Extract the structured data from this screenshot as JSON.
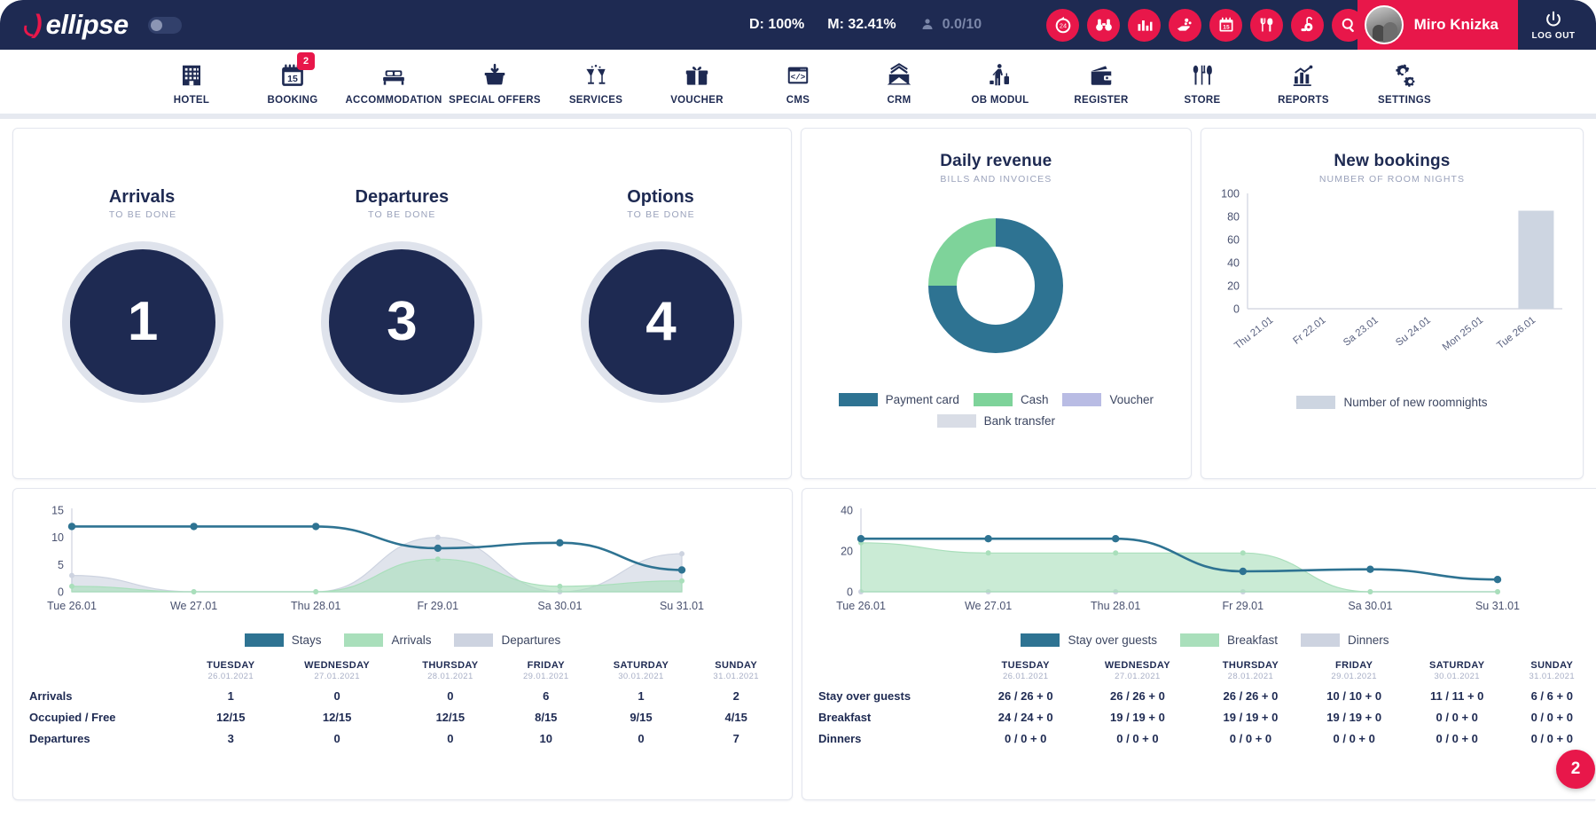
{
  "brand": {
    "name": "ellipse"
  },
  "topbar": {
    "toggle_name": "sidebar-toggle",
    "status": {
      "d_label": "D: 100%",
      "m_label": "M: 32.41%",
      "guest_rating": "0.0/10"
    },
    "icons": [
      {
        "name": "24h-clock-icon"
      },
      {
        "name": "binoculars-icon"
      },
      {
        "name": "bar-chart-icon"
      },
      {
        "name": "housekeeping-icon"
      },
      {
        "name": "calendar-icon"
      },
      {
        "name": "restaurant-icon"
      },
      {
        "name": "vacuum-icon"
      },
      {
        "name": "search-icon"
      }
    ],
    "user": {
      "name": "Miro Knizka"
    },
    "logout": {
      "label": "LOG OUT"
    }
  },
  "mainnav": [
    {
      "label": "HOTEL",
      "icon": "hotel-icon",
      "badge": null
    },
    {
      "label": "BOOKING",
      "icon": "calendar-15-icon",
      "badge": "2"
    },
    {
      "label": "ACCOMMODATION",
      "icon": "bed-icon",
      "badge": null
    },
    {
      "label": "SPECIAL OFFERS",
      "icon": "package-icon",
      "badge": null
    },
    {
      "label": "SERVICES",
      "icon": "cheers-icon",
      "badge": null
    },
    {
      "label": "VOUCHER",
      "icon": "gift-icon",
      "badge": null
    },
    {
      "label": "CMS",
      "icon": "code-window-icon",
      "badge": null
    },
    {
      "label": "CRM",
      "icon": "envelope-icon",
      "badge": null
    },
    {
      "label": "OB MODUL",
      "icon": "traveler-icon",
      "badge": null
    },
    {
      "label": "REGISTER",
      "icon": "wallet-icon",
      "badge": null
    },
    {
      "label": "STORE",
      "icon": "cutlery-icon",
      "badge": null
    },
    {
      "label": "REPORTS",
      "icon": "report-chart-icon",
      "badge": null
    },
    {
      "label": "SETTINGS",
      "icon": "gears-icon",
      "badge": null
    }
  ],
  "kpis": [
    {
      "title": "Arrivals",
      "subtitle": "TO BE DONE",
      "value": "1"
    },
    {
      "title": "Departures",
      "subtitle": "TO BE DONE",
      "value": "3"
    },
    {
      "title": "Options",
      "subtitle": "TO BE DONE",
      "value": "4"
    }
  ],
  "colors": {
    "navy": "#1e2a52",
    "accent_red": "#e8174a",
    "teal": "#2e7392",
    "green": "#7ed39a",
    "lavender": "#b9bce4",
    "light_gray": "#d3d9e4"
  },
  "daily_revenue": {
    "title": "Daily revenue",
    "subtitle": "BILLS AND INVOICES"
  },
  "new_bookings": {
    "title": "New bookings",
    "subtitle": "NUMBER OF ROOM NIGHTS",
    "legend_label": "Number of new roomnights"
  },
  "chart_data": [
    {
      "type": "pie",
      "title": "Daily revenue",
      "subtitle": "BILLS AND INVOICES",
      "labels": [
        "Payment card",
        "Cash",
        "Voucher",
        "Bank transfer"
      ],
      "values": [
        75,
        25,
        0,
        0
      ],
      "colors": [
        "#2e7392",
        "#7ed39a",
        "#b9bce4",
        "#d9dde6"
      ],
      "legend_position": "bottom",
      "donut": true
    },
    {
      "type": "bar",
      "title": "New bookings",
      "subtitle": "NUMBER OF ROOM NIGHTS",
      "categories": [
        "Thu 21.01",
        "Fr 22.01",
        "Sa 23.01",
        "Su 24.01",
        "Mon 25.01",
        "Tue 26.01"
      ],
      "values": [
        0,
        0,
        0,
        0,
        0,
        85
      ],
      "ylim": [
        0,
        100
      ],
      "yticks": [
        0,
        20,
        40,
        60,
        80,
        100
      ],
      "series_name": "Number of new roomnights",
      "color": "#cdd5e1",
      "grid": false,
      "legend_position": "bottom"
    },
    {
      "type": "area",
      "title": "Occupancy overview",
      "categories": [
        "Tue 26.01",
        "We 27.01",
        "Thu 28.01",
        "Fr 29.01",
        "Sa 30.01",
        "Su 31.01"
      ],
      "ylim": [
        0,
        15
      ],
      "yticks": [
        0,
        5,
        10,
        15
      ],
      "series": [
        {
          "name": "Stays",
          "values": [
            12,
            12,
            12,
            8,
            9,
            4
          ],
          "color": "#2e7392",
          "style": "line"
        },
        {
          "name": "Arrivals",
          "values": [
            1,
            0,
            0,
            6,
            1,
            2
          ],
          "color": "#a9dfbb",
          "style": "area"
        },
        {
          "name": "Departures",
          "values": [
            3,
            0,
            0,
            10,
            0,
            7
          ],
          "color": "#cdd3e0",
          "style": "area"
        }
      ],
      "legend_position": "bottom"
    },
    {
      "type": "area",
      "title": "Guest services overview",
      "categories": [
        "Tue 26.01",
        "We 27.01",
        "Thu 28.01",
        "Fr 29.01",
        "Sa 30.01",
        "Su 31.01"
      ],
      "ylim": [
        0,
        40
      ],
      "yticks": [
        0,
        20,
        40
      ],
      "series": [
        {
          "name": "Stay over guests",
          "values": [
            26,
            26,
            26,
            10,
            11,
            6
          ],
          "color": "#2e7392",
          "style": "line"
        },
        {
          "name": "Breakfast",
          "values": [
            24,
            19,
            19,
            19,
            0,
            0
          ],
          "color": "#a9dfbb",
          "style": "area"
        },
        {
          "name": "Dinners",
          "values": [
            0,
            0,
            0,
            0,
            0,
            0
          ],
          "color": "#cdd3e0",
          "style": "area"
        }
      ],
      "legend_position": "bottom"
    }
  ],
  "left_table": {
    "days": [
      {
        "name": "TUESDAY",
        "date": "26.01.2021"
      },
      {
        "name": "WEDNESDAY",
        "date": "27.01.2021"
      },
      {
        "name": "THURSDAY",
        "date": "28.01.2021"
      },
      {
        "name": "FRIDAY",
        "date": "29.01.2021"
      },
      {
        "name": "SATURDAY",
        "date": "30.01.2021"
      },
      {
        "name": "SUNDAY",
        "date": "31.01.2021"
      }
    ],
    "rows": [
      {
        "label": "Arrivals",
        "values": [
          "1",
          "0",
          "0",
          "6",
          "1",
          "2"
        ]
      },
      {
        "label": "Occupied / Free",
        "values": [
          "12/15",
          "12/15",
          "12/15",
          "8/15",
          "9/15",
          "4/15"
        ]
      },
      {
        "label": "Departures",
        "values": [
          "3",
          "0",
          "0",
          "10",
          "0",
          "7"
        ]
      }
    ]
  },
  "right_table": {
    "days": [
      {
        "name": "TUESDAY",
        "date": "26.01.2021"
      },
      {
        "name": "WEDNESDAY",
        "date": "27.01.2021"
      },
      {
        "name": "THURSDAY",
        "date": "28.01.2021"
      },
      {
        "name": "FRIDAY",
        "date": "29.01.2021"
      },
      {
        "name": "SATURDAY",
        "date": "30.01.2021"
      },
      {
        "name": "SUNDAY",
        "date": "31.01.2021"
      }
    ],
    "rows": [
      {
        "label": "Stay over guests",
        "values": [
          "26 / 26 + 0",
          "26 / 26 + 0",
          "26 / 26 + 0",
          "10 / 10 + 0",
          "11 / 11 + 0",
          "6 / 6 + 0"
        ]
      },
      {
        "label": "Breakfast",
        "values": [
          "24 / 24 + 0",
          "19 / 19 + 0",
          "19 / 19 + 0",
          "19 / 19 + 0",
          "0 / 0 + 0",
          "0 / 0 + 0"
        ]
      },
      {
        "label": "Dinners",
        "values": [
          "0 / 0 + 0",
          "0 / 0 + 0",
          "0 / 0 + 0",
          "0 / 0 + 0",
          "0 / 0 + 0",
          "0 / 0 + 0"
        ]
      }
    ]
  },
  "corner_badge": {
    "value": "2"
  }
}
